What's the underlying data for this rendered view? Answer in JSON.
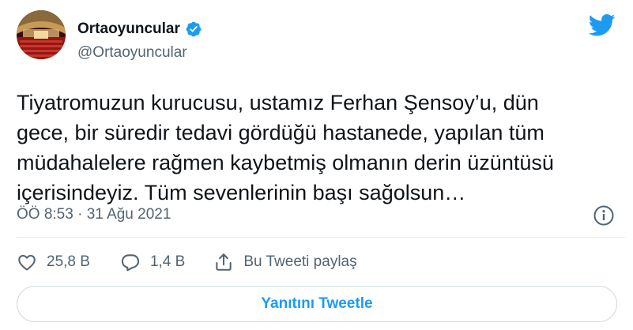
{
  "account": {
    "name": "Ortaoyuncular",
    "handle": "@Ortaoyuncular",
    "verified_icon": "verified-badge-icon",
    "avatar_icon": "theater-hall-avatar"
  },
  "tweet": {
    "lines": [
      "Tiyatromuzun kurucusu, ustamız Ferhan Şensoy’u, dün",
      "gece, bir süredir tedavi gördüğü hastanede, yapılan tüm",
      "müdahalelere rağmen kaybetmiş olmanın derin üzüntüsü",
      "içerisindeyiz. Tüm sevenlerinin başı sağolsun…"
    ],
    "timestamp": "ÖÖ 8:53 · 31 Ağu 2021"
  },
  "actions": {
    "likes": "25,8 B",
    "replies": "1,4 B",
    "share_label": "Bu Tweeti paylaş"
  },
  "reply_button_label": "Yanıtını Tweetle",
  "colors": {
    "accent": "#1d9bf0",
    "muted": "#536471",
    "text": "#0f1419",
    "border": "#cfd9de"
  }
}
